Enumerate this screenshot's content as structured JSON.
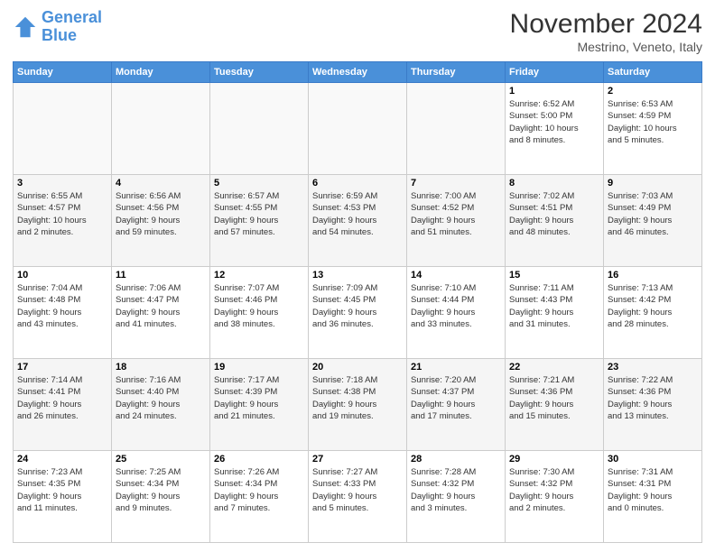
{
  "header": {
    "logo_line1": "General",
    "logo_line2": "Blue",
    "month_title": "November 2024",
    "location": "Mestrino, Veneto, Italy"
  },
  "days_of_week": [
    "Sunday",
    "Monday",
    "Tuesday",
    "Wednesday",
    "Thursday",
    "Friday",
    "Saturday"
  ],
  "weeks": [
    [
      {
        "day": "",
        "info": ""
      },
      {
        "day": "",
        "info": ""
      },
      {
        "day": "",
        "info": ""
      },
      {
        "day": "",
        "info": ""
      },
      {
        "day": "",
        "info": ""
      },
      {
        "day": "1",
        "info": "Sunrise: 6:52 AM\nSunset: 5:00 PM\nDaylight: 10 hours\nand 8 minutes."
      },
      {
        "day": "2",
        "info": "Sunrise: 6:53 AM\nSunset: 4:59 PM\nDaylight: 10 hours\nand 5 minutes."
      }
    ],
    [
      {
        "day": "3",
        "info": "Sunrise: 6:55 AM\nSunset: 4:57 PM\nDaylight: 10 hours\nand 2 minutes."
      },
      {
        "day": "4",
        "info": "Sunrise: 6:56 AM\nSunset: 4:56 PM\nDaylight: 9 hours\nand 59 minutes."
      },
      {
        "day": "5",
        "info": "Sunrise: 6:57 AM\nSunset: 4:55 PM\nDaylight: 9 hours\nand 57 minutes."
      },
      {
        "day": "6",
        "info": "Sunrise: 6:59 AM\nSunset: 4:53 PM\nDaylight: 9 hours\nand 54 minutes."
      },
      {
        "day": "7",
        "info": "Sunrise: 7:00 AM\nSunset: 4:52 PM\nDaylight: 9 hours\nand 51 minutes."
      },
      {
        "day": "8",
        "info": "Sunrise: 7:02 AM\nSunset: 4:51 PM\nDaylight: 9 hours\nand 48 minutes."
      },
      {
        "day": "9",
        "info": "Sunrise: 7:03 AM\nSunset: 4:49 PM\nDaylight: 9 hours\nand 46 minutes."
      }
    ],
    [
      {
        "day": "10",
        "info": "Sunrise: 7:04 AM\nSunset: 4:48 PM\nDaylight: 9 hours\nand 43 minutes."
      },
      {
        "day": "11",
        "info": "Sunrise: 7:06 AM\nSunset: 4:47 PM\nDaylight: 9 hours\nand 41 minutes."
      },
      {
        "day": "12",
        "info": "Sunrise: 7:07 AM\nSunset: 4:46 PM\nDaylight: 9 hours\nand 38 minutes."
      },
      {
        "day": "13",
        "info": "Sunrise: 7:09 AM\nSunset: 4:45 PM\nDaylight: 9 hours\nand 36 minutes."
      },
      {
        "day": "14",
        "info": "Sunrise: 7:10 AM\nSunset: 4:44 PM\nDaylight: 9 hours\nand 33 minutes."
      },
      {
        "day": "15",
        "info": "Sunrise: 7:11 AM\nSunset: 4:43 PM\nDaylight: 9 hours\nand 31 minutes."
      },
      {
        "day": "16",
        "info": "Sunrise: 7:13 AM\nSunset: 4:42 PM\nDaylight: 9 hours\nand 28 minutes."
      }
    ],
    [
      {
        "day": "17",
        "info": "Sunrise: 7:14 AM\nSunset: 4:41 PM\nDaylight: 9 hours\nand 26 minutes."
      },
      {
        "day": "18",
        "info": "Sunrise: 7:16 AM\nSunset: 4:40 PM\nDaylight: 9 hours\nand 24 minutes."
      },
      {
        "day": "19",
        "info": "Sunrise: 7:17 AM\nSunset: 4:39 PM\nDaylight: 9 hours\nand 21 minutes."
      },
      {
        "day": "20",
        "info": "Sunrise: 7:18 AM\nSunset: 4:38 PM\nDaylight: 9 hours\nand 19 minutes."
      },
      {
        "day": "21",
        "info": "Sunrise: 7:20 AM\nSunset: 4:37 PM\nDaylight: 9 hours\nand 17 minutes."
      },
      {
        "day": "22",
        "info": "Sunrise: 7:21 AM\nSunset: 4:36 PM\nDaylight: 9 hours\nand 15 minutes."
      },
      {
        "day": "23",
        "info": "Sunrise: 7:22 AM\nSunset: 4:36 PM\nDaylight: 9 hours\nand 13 minutes."
      }
    ],
    [
      {
        "day": "24",
        "info": "Sunrise: 7:23 AM\nSunset: 4:35 PM\nDaylight: 9 hours\nand 11 minutes."
      },
      {
        "day": "25",
        "info": "Sunrise: 7:25 AM\nSunset: 4:34 PM\nDaylight: 9 hours\nand 9 minutes."
      },
      {
        "day": "26",
        "info": "Sunrise: 7:26 AM\nSunset: 4:34 PM\nDaylight: 9 hours\nand 7 minutes."
      },
      {
        "day": "27",
        "info": "Sunrise: 7:27 AM\nSunset: 4:33 PM\nDaylight: 9 hours\nand 5 minutes."
      },
      {
        "day": "28",
        "info": "Sunrise: 7:28 AM\nSunset: 4:32 PM\nDaylight: 9 hours\nand 3 minutes."
      },
      {
        "day": "29",
        "info": "Sunrise: 7:30 AM\nSunset: 4:32 PM\nDaylight: 9 hours\nand 2 minutes."
      },
      {
        "day": "30",
        "info": "Sunrise: 7:31 AM\nSunset: 4:31 PM\nDaylight: 9 hours\nand 0 minutes."
      }
    ]
  ]
}
